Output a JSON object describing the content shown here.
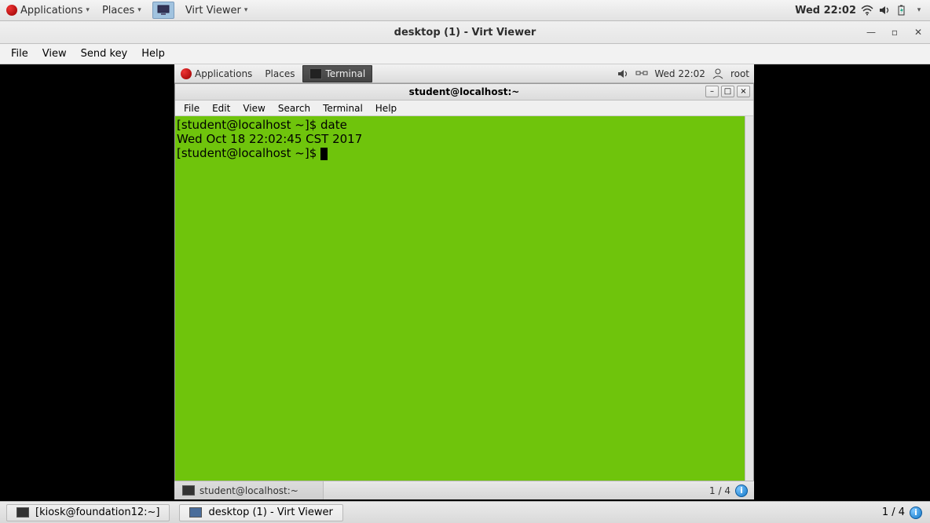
{
  "host_panel": {
    "applications": "Applications",
    "places": "Places",
    "launcher_title": "Virt Viewer",
    "clock": "Wed 22:02"
  },
  "virtviewer": {
    "title": "desktop (1) - Virt Viewer",
    "menus": {
      "file": "File",
      "view": "View",
      "sendkey": "Send key",
      "help": "Help"
    }
  },
  "guest_panel": {
    "applications": "Applications",
    "places": "Places",
    "task_label": "Terminal",
    "clock": "Wed 22:02",
    "user": "root"
  },
  "terminal": {
    "title": "student@localhost:~",
    "menus": {
      "file": "File",
      "edit": "Edit",
      "view": "View",
      "search": "Search",
      "terminal": "Terminal",
      "help": "Help"
    },
    "lines": [
      "[student@localhost ~]$ date",
      "Wed Oct 18 22:02:45 CST 2017",
      "[student@localhost ~]$ "
    ]
  },
  "guest_bottom": {
    "task_label": "student@localhost:~",
    "workspace": "1 / 4"
  },
  "host_bottom": {
    "task1": "[kiosk@foundation12:~]",
    "task2": "desktop (1) - Virt Viewer",
    "workspace": "1 / 4"
  }
}
